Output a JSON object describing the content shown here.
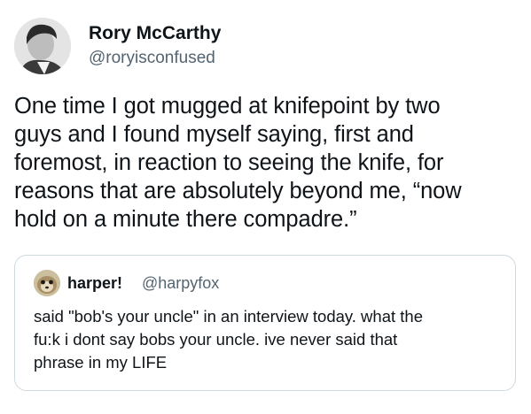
{
  "tweet": {
    "author_name": "Rory McCarthy",
    "author_handle": "@roryisconfused",
    "avatar_icon": "profile-photo",
    "text_lines": [
      "One time I got mugged at knifepoint by two",
      "guys and I found myself saying, first and",
      "foremost, in reaction to seeing the knife, for",
      "reasons that are absolutely beyond me, “now",
      "hold on a minute there compadre.”"
    ]
  },
  "quoted_tweet": {
    "author_name": "harper!",
    "author_handle": "@harpyfox",
    "avatar_icon": "meerkat-profile-photo",
    "text_lines": [
      "said \"bob's your uncle\" in an interview today. what the",
      "fu:k i dont say bobs your uncle. ive never said that",
      "phrase in my LIFE"
    ]
  },
  "colors": {
    "text": "#0f1419",
    "secondary_text": "#536471",
    "border": "#cfd9de"
  }
}
